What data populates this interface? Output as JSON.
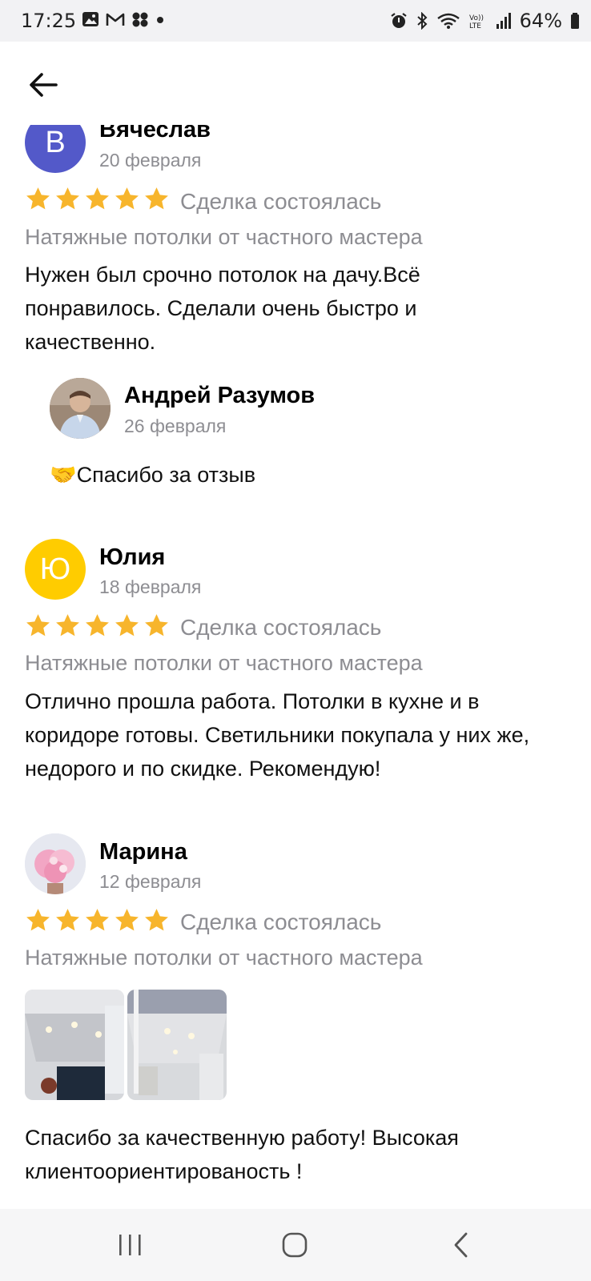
{
  "status_bar": {
    "time": "17:25",
    "battery": "64%",
    "left_icons": [
      "image-icon",
      "gmail-icon",
      "apps-icon",
      "dot-icon"
    ],
    "right_icons": [
      "alarm-icon",
      "bluetooth-icon",
      "wifi-icon",
      "volte-icon",
      "signal-icon",
      "battery-icon"
    ]
  },
  "colors": {
    "star": "#f7b52c",
    "muted": "#8d8d92",
    "avatar_blue": "#5359c9",
    "avatar_yellow": "#ffcc00"
  },
  "reviews": [
    {
      "avatar_letter": "В",
      "name": "Вячеслав",
      "date": "20 февраля",
      "rating": 5,
      "deal_status": "Сделка состоялась",
      "service": "Натяжные потолки от частного мастера",
      "text": "Нужен был срочно потолок на дачу.Всё понравилось. Сделали очень быстро и качественно.",
      "reply": {
        "name": "Андрей Разумов",
        "date": "26 февраля",
        "text": "🤝Спасибо за отзыв"
      }
    },
    {
      "avatar_letter": "Ю",
      "name": "Юлия",
      "date": "18 февраля",
      "rating": 5,
      "deal_status": "Сделка состоялась",
      "service": "Натяжные потолки от частного мастера",
      "text": "Отлично прошла работа. Потолки в кухне и в коридоре готовы. Светильники покупала у них же, недорого и по скидке. Рекомендую!"
    },
    {
      "name": "Марина",
      "date": "12 февраля",
      "rating": 5,
      "deal_status": "Сделка состоялась",
      "service": "Натяжные потолки от частного мастера",
      "photos": 2,
      "text": "Спасибо за качественную работу! Высокая клиентоориентированость !"
    }
  ]
}
